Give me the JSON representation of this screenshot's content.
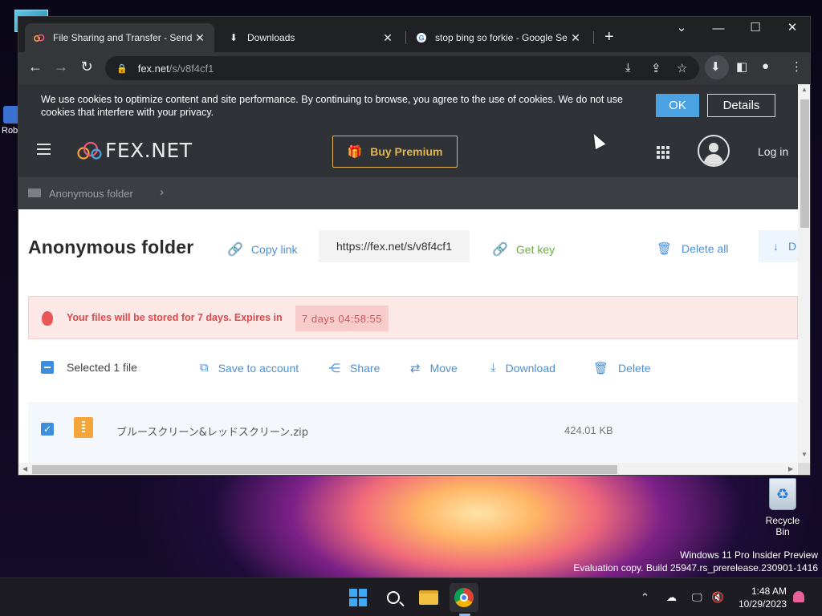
{
  "desktop": {
    "robo_label": "Rob",
    "recycle_bin_label": "Recycle Bin",
    "watermark_line1": "Windows 11 Pro Insider Preview",
    "watermark_line2": "Evaluation copy. Build 25947.rs_prerelease.230901-1416"
  },
  "browser": {
    "tabs": [
      {
        "title": "File Sharing and Transfer - Send",
        "icon": "fex-icon",
        "active": true
      },
      {
        "title": "Downloads",
        "icon": "download-icon",
        "active": false
      },
      {
        "title": "stop bing so forkie - Google Se",
        "icon": "google-icon",
        "active": false
      }
    ],
    "address": {
      "host": "fex.net",
      "path": "/s/v8f4cf1"
    }
  },
  "page": {
    "cookie": {
      "text": "We use cookies to optimize content and site performance. By continuing to browse, you agree to the use of cookies. We do not use cookies that interfere with your privacy.",
      "ok_label": "OK",
      "details_label": "Details"
    },
    "header": {
      "logo_text": "FEX.NET",
      "premium_label": "Buy Premium",
      "login_label": "Log in"
    },
    "breadcrumb": {
      "label": "Anonymous folder"
    },
    "folder": {
      "title": "Anonymous folder",
      "copy_link_label": "Copy link",
      "url": "https://fex.net/s/v8f4cf1",
      "get_key_label": "Get key",
      "delete_all_label": "Delete all",
      "download_partial_label": "D"
    },
    "expiry": {
      "text": "Your files will be stored for 7 days. Expires in",
      "timer": "7 days  04:58:55"
    },
    "actions": {
      "selected_label": "Selected 1 file",
      "save_label": "Save to account",
      "share_label": "Share",
      "move_label": "Move",
      "download_label": "Download",
      "delete_label": "Delete"
    },
    "files": [
      {
        "name": "ブルースクリーン&レッドスクリーン.zip",
        "size": "424.01 KB",
        "checked": true
      }
    ]
  },
  "taskbar": {
    "time": "1:48 AM",
    "date": "10/29/2023"
  },
  "colors": {
    "accent": "#4aa2e3",
    "premium": "#e4b74a",
    "expiry_red": "#e04848",
    "get_key_green": "#6ab03b"
  }
}
